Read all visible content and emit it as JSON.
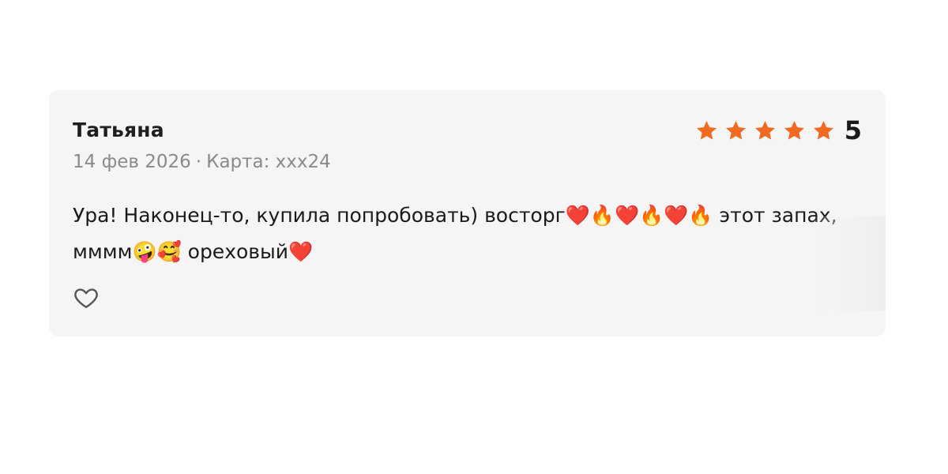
{
  "review": {
    "author": "Татьяна",
    "date": "14 фев 2026",
    "separator": "·",
    "card_label": "Карта: ххх24",
    "rating": {
      "value": "5",
      "stars_filled": 5,
      "stars_total": 5,
      "star_color": "#f26a21"
    },
    "text": "Ура! Наконец-то, купила попробовать) восторг❤️🔥❤️🔥❤️🔥 этот запах, мммм🤪🥰 ореховый❤️"
  },
  "icons": {
    "star": "star-icon",
    "like": "heart-outline-icon"
  },
  "colors": {
    "card_background": "#f5f5f5",
    "text_primary": "#1a1a1a",
    "text_secondary": "#8a8a8a",
    "accent": "#f26a21"
  }
}
